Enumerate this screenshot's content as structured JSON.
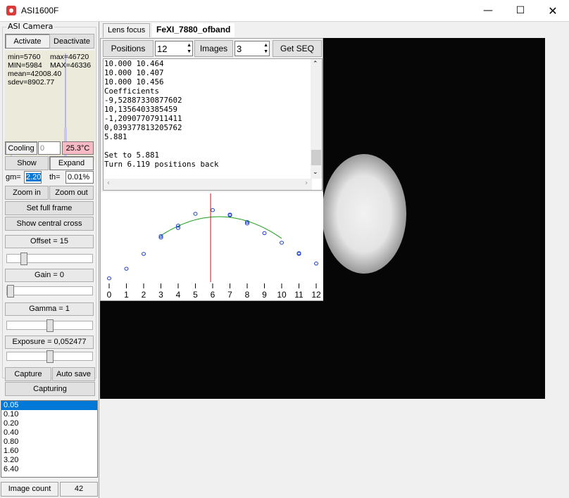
{
  "window": {
    "title": "ASI1600F"
  },
  "camera_group": {
    "label": "ASI Camera",
    "activate": "Activate",
    "deactivate": "Deactivate"
  },
  "stats": {
    "min": "min=5760",
    "max": "max=46720",
    "MIN": "MIN=5984",
    "MAX": "MAX=46336",
    "mean": "mean=42008.40",
    "sdev": "sdev=8902.77"
  },
  "cooling": {
    "button": "Cooling",
    "setpoint": "0",
    "temperature": "25.3°C",
    "temp_color": "#f7b9c4"
  },
  "view": {
    "show": "Show",
    "expand": "Expand",
    "gm_label": "gm=",
    "gm_value": "2.20",
    "th_label": "th=",
    "th_value": "0.01%",
    "zoom_in": "Zoom in",
    "zoom_out": "Zoom out",
    "full_frame": "Set full frame",
    "central_cross": "Show central cross"
  },
  "sliders": {
    "offset": {
      "label": "Offset = 15",
      "level": 0.17
    },
    "gain": {
      "label": "Gain = 0",
      "level": 0.0
    },
    "gamma": {
      "label": "Gamma = 1",
      "level": 0.5
    },
    "exposure": {
      "label": "Exposure = 0,052477",
      "level": 0.5
    }
  },
  "capture": {
    "capture": "Capture",
    "auto_save": "Auto save",
    "capturing": "Capturing"
  },
  "exposures": [
    "0.05",
    "0.10",
    "0.20",
    "0.40",
    "0.80",
    "1.60",
    "3.20",
    "6.40"
  ],
  "status": {
    "image_count_label": "Image count",
    "image_count": "42"
  },
  "tabs": [
    "Lens focus",
    "FeXI_7880_ofband"
  ],
  "focus": {
    "positions_label": "Positions",
    "positions_value": "12",
    "images_label": "Images",
    "images_value": "3",
    "get_seq": "Get SEQ",
    "log": [
      "10.000 10.464",
      "10.000 10.407",
      "10.000 10.456",
      "Coefficients",
      "-9,52887330877602",
      "10,1356403385459",
      "-1,20907707911411",
      "0,039377813205762",
      "5.881",
      "",
      "Set to 5.881",
      "Turn 6.119 positions back"
    ]
  },
  "chart_data": {
    "type": "scatter",
    "x_ticks": [
      "0",
      "1",
      "2",
      "3",
      "4",
      "5",
      "6",
      "7",
      "8",
      "9",
      "10",
      "11",
      "12"
    ],
    "points": [
      [
        0,
        0.5
      ],
      [
        1,
        1.8
      ],
      [
        2,
        3.8
      ],
      [
        3,
        6.0
      ],
      [
        3,
        6.2
      ],
      [
        4,
        7.3
      ],
      [
        4,
        7.6
      ],
      [
        5,
        9.2
      ],
      [
        6,
        9.7
      ],
      [
        7,
        9.0
      ],
      [
        7,
        9.1
      ],
      [
        8,
        7.9
      ],
      [
        8,
        8.1
      ],
      [
        9,
        6.6
      ],
      [
        10,
        5.3
      ],
      [
        11,
        3.8
      ],
      [
        11,
        3.9
      ],
      [
        12,
        2.5
      ]
    ],
    "fit_curve_range": [
      3,
      10
    ],
    "fit_color": "#1a9e1a",
    "point_color": "#1a3cc8",
    "marker_x": 5.881,
    "marker_color": "#cc1010",
    "ylim": [
      0,
      11
    ],
    "xlim": [
      0,
      12
    ]
  }
}
